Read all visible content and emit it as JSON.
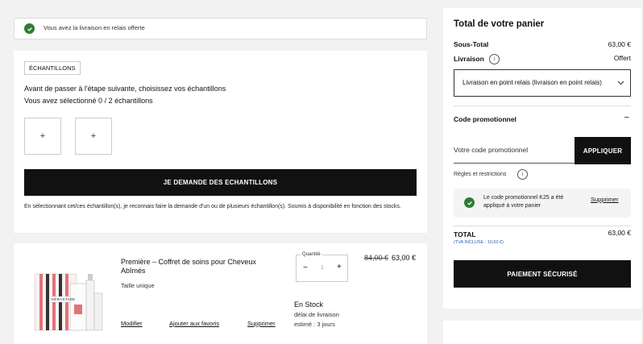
{
  "banner": {
    "text": "Vous avez la livraison en relais offerte"
  },
  "samples": {
    "tag": "ÉCHANTILLONS",
    "line1": "Avant de passer à l'étape suivante, choisissez vos échantillons",
    "line2": "Vous avez sélectionné 0 / 2 échantillons",
    "slot_glyph": "+",
    "button": "JE DEMANDE DES ECHANTILLONS",
    "disclaimer": "En sélectionnant cet/ces échantillon(s), je reconnais faire la demande d'un ou de plusieurs échantillon(s). Soumis à disponibilité en fonction des stocks."
  },
  "product": {
    "title": "Première – Coffret de soins pour Cheveux Abîmés",
    "size": "Taille unique",
    "quantity_label": "Quantité",
    "quantity_value": "1",
    "minus": "−",
    "plus": "+",
    "old_price": "84,00 €",
    "price": "63,00 €",
    "stock": "En Stock",
    "delivery": "délai de livraison estimé : 3 jours",
    "modify": "Modifier",
    "favorite": "Ajouter aux favoris",
    "delete": "Supprimer",
    "brand": "KÉRASTASE"
  },
  "summary": {
    "title": "Total de votre panier",
    "subtotal_label": "Sous-Total",
    "subtotal_value": "63,00 €",
    "shipping_label": "Livraison",
    "shipping_value": "Offert",
    "shipping_select": "Livraison en point relais (livraison en point relais)",
    "promo_title": "Code promotionnel",
    "promo_toggle": "−",
    "promo_placeholder": "Votre code promotionnel",
    "apply_button": "APPLIQUER",
    "rules": "Règles et restrictions",
    "promo_applied": "Le code promotionnel K25 a été appliqué à votre panier",
    "promo_remove": "Supprimer",
    "total_label": "TOTAL",
    "total_tax": "(TVA INCLUSE : 10,50 €)",
    "total_value": "63,00 €",
    "pay_button": "PAIEMENT SÉCURISÉ"
  }
}
